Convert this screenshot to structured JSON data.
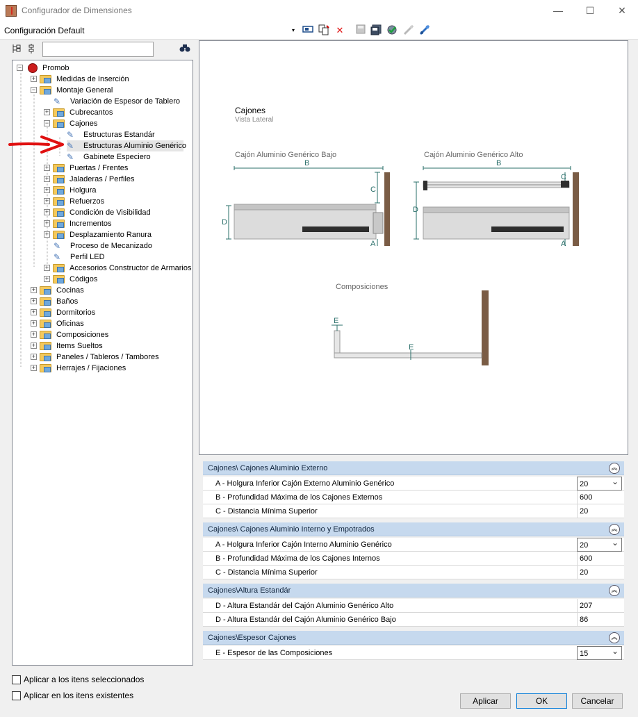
{
  "window": {
    "title": "Configurador de Dimensiones",
    "minimize": "—",
    "maximize": "☐",
    "close": "✕"
  },
  "toolbar": {
    "config_value": "Configuración Default",
    "dropdown_arrow": "▾"
  },
  "search": {
    "value": ""
  },
  "tree": {
    "root": "Promob",
    "items": [
      "Medidas de Inserción",
      "Montaje General",
      "Variación de Espesor de Tablero",
      "Cubrecantos",
      "Cajones",
      "Estructuras Estandár",
      "Estructuras Aluminio Genérico",
      "Gabinete Especiero",
      "Puertas / Frentes",
      "Jaladeras / Perfiles",
      "Holgura",
      "Refuerzos",
      "Condición de Visibilidad",
      "Incrementos",
      "Desplazamiento Ranura",
      "Proceso de Mecanizado",
      "Perfil LED",
      "Accesorios Constructor de Armarios",
      "Códigos",
      "Cocinas",
      "Baños",
      "Dormitorios",
      "Oficinas",
      "Composiciones",
      "Items Sueltos",
      "Paneles / Tableros / Tambores",
      "Herrajes / Fijaciones"
    ]
  },
  "preview": {
    "title": "Cajones",
    "subtitle": "Vista Lateral",
    "left_caption": "Cajón Aluminio Genérico Bajo",
    "right_caption": "Cajón Aluminio Genérico Alto",
    "bottom_caption": "Composiciones",
    "letters": {
      "a": "A",
      "b": "B",
      "c": "C",
      "d": "D",
      "e": "E"
    }
  },
  "groups": [
    {
      "title": "Cajones\\ Cajones Aluminio Externo",
      "rows": [
        {
          "label": "A - Holgura Inferior Cajón Externo Aluminio Genérico",
          "value": "20"
        },
        {
          "label": "B - Profundidad Máxima de los Cajones Externos",
          "value": "600"
        },
        {
          "label": "C - Distancia Mínima Superior",
          "value": "20"
        }
      ]
    },
    {
      "title": "Cajones\\ Cajones Aluminio Interno y Empotrados",
      "rows": [
        {
          "label": "A - Holgura Inferior Cajón Interno Aluminio Genérico",
          "value": "20"
        },
        {
          "label": "B - Profundidad Máxima de los Cajones Internos",
          "value": "600"
        },
        {
          "label": "C - Distancia Mínima Superior",
          "value": "20"
        }
      ]
    },
    {
      "title": "Cajones\\Altura Estandár",
      "rows": [
        {
          "label": "D - Altura Estandár del Cajón Aluminio Genérico Alto",
          "value": "207"
        },
        {
          "label": "D - Altura Estandár del Cajón Aluminio Genérico Bajo",
          "value": "86"
        }
      ]
    },
    {
      "title": "Cajones\\Espesor Cajones",
      "rows": [
        {
          "label": "E - Espesor de las Composiciones",
          "value": "15"
        }
      ]
    }
  ],
  "options": {
    "apply_selected": "Aplicar a los itens seleccionados",
    "apply_existing": "Aplicar en los itens existentes"
  },
  "buttons": {
    "apply": "Aplicar",
    "ok": "OK",
    "cancel": "Cancelar"
  },
  "collapse_glyph": "︽",
  "colors": {
    "header": "#c6d9ee",
    "accent": "#0078d7",
    "wood": "#7a5c45",
    "dim": "#2a6f6a",
    "arrow": "#e01010"
  }
}
